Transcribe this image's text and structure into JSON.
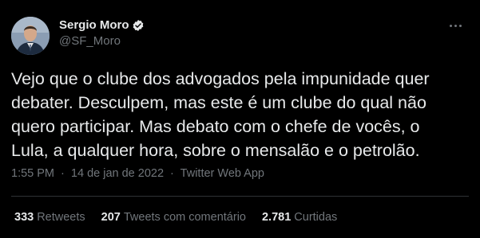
{
  "author": {
    "name": "Sergio Moro",
    "handle": "@SF_Moro",
    "verified": true
  },
  "tweet": {
    "text": "Vejo que o clube dos advogados pela impunidade quer\ndebater. Desculpem, mas este é um clube do qual não\nquero participar. Mas debato com o chefe de vocês, o\nLula, a qualquer hora, sobre o mensalão e o petrolão.",
    "time": "1:55 PM",
    "date": "14 de jan de 2022",
    "separator": "·",
    "source": "Twitter Web App"
  },
  "stats": [
    {
      "count": "333",
      "label": "Retweets"
    },
    {
      "count": "207",
      "label": "Tweets com comentário"
    },
    {
      "count": "2.781",
      "label": "Curtidas"
    }
  ],
  "icons": {
    "verified": "verified-badge-icon",
    "more": "more-options-icon"
  },
  "colors": {
    "background": "#000000",
    "text_primary": "#e7e9ea",
    "text_secondary": "#71767b",
    "divider": "#2f3336"
  }
}
